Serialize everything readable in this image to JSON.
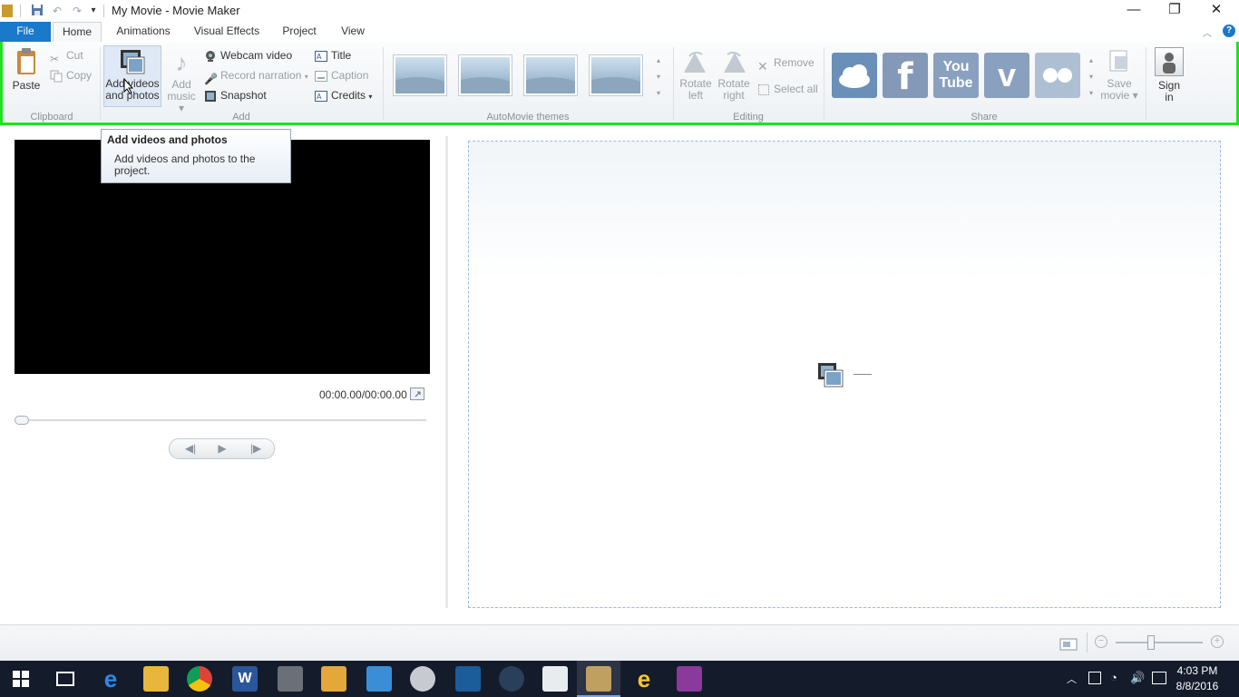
{
  "window": {
    "title": "My Movie - Movie Maker"
  },
  "tabs": [
    {
      "label": "File"
    },
    {
      "label": "Home"
    },
    {
      "label": "Animations"
    },
    {
      "label": "Visual Effects"
    },
    {
      "label": "Project"
    },
    {
      "label": "View"
    }
  ],
  "ribbon": {
    "clipboard": {
      "label": "Clipboard",
      "paste": "Paste",
      "cut": "Cut",
      "copy": "Copy"
    },
    "add": {
      "label": "Add",
      "add_videos_line1": "Add videos",
      "add_videos_line2": "and photos",
      "add_music_line1": "Add",
      "add_music_line2": "music",
      "webcam_video": "Webcam video",
      "record_narration": "Record narration",
      "snapshot": "Snapshot",
      "title": "Title",
      "caption": "Caption",
      "credits": "Credits"
    },
    "themes": {
      "label": "AutoMovie themes"
    },
    "editing": {
      "label": "Editing",
      "rotate_left_1": "Rotate",
      "rotate_left_2": "left",
      "rotate_right_1": "Rotate",
      "rotate_right_2": "right",
      "remove": "Remove",
      "select_all": "Select all"
    },
    "share": {
      "label": "Share",
      "youtube_1": "You",
      "youtube_2": "Tube",
      "save_movie_1": "Save",
      "save_movie_2": "movie",
      "sign_in_1": "Sign",
      "sign_in_2": "in"
    }
  },
  "tooltip": {
    "title": "Add videos and photos",
    "desc_line1": "Add videos and photos to the",
    "desc_line2": "project."
  },
  "player": {
    "time": "00:00.00/00:00.00"
  },
  "clock": {
    "time": "4:03 PM",
    "date": "8/8/2016"
  },
  "colors": {
    "file_tab": "#1979ca",
    "highlight": "#22e022",
    "taskbar": "#141b2a"
  }
}
